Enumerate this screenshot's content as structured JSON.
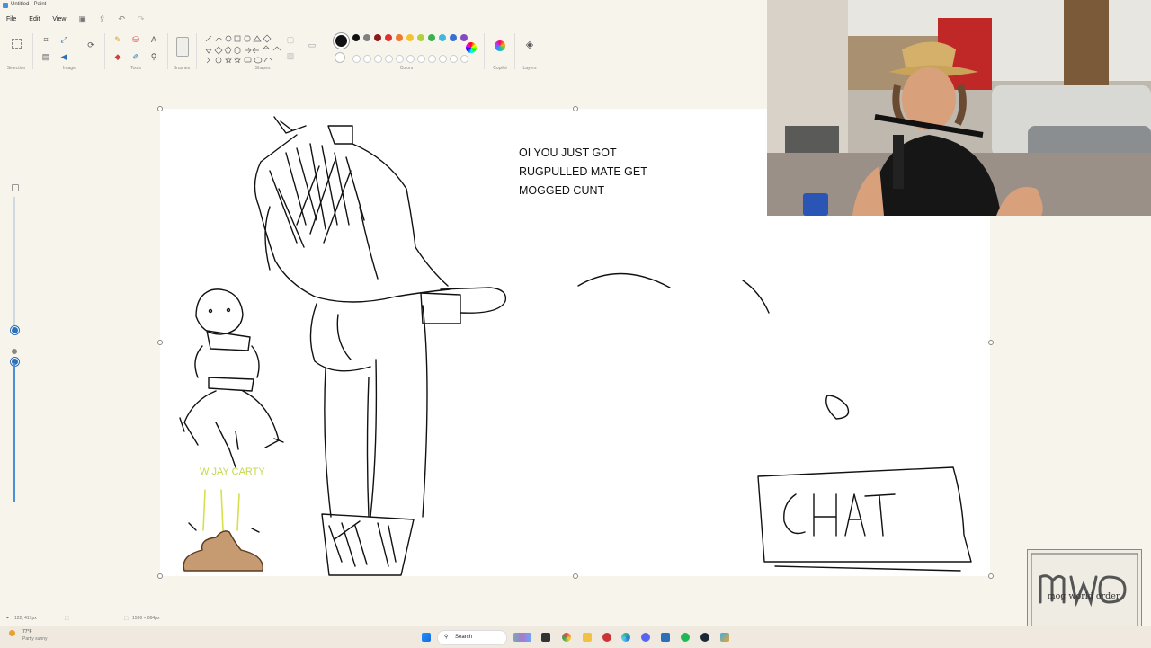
{
  "window": {
    "title": "Untitled - Paint"
  },
  "menu": {
    "file": "File",
    "edit": "Edit",
    "view": "View"
  },
  "ribbon": {
    "selection_label": "Selection",
    "image_label": "Image",
    "tools_label": "Tools",
    "brushes_label": "Brushes",
    "shapes_label": "Shapes",
    "colors_label": "Colors",
    "copilot_label": "Copilot",
    "layers_label": "Layers"
  },
  "palette": {
    "primary": "#111111",
    "row1": [
      "#111111",
      "#808080",
      "#8b1a1a",
      "#e03030",
      "#f07830",
      "#f4c430",
      "#b0d040",
      "#3cb050",
      "#40b8e0",
      "#3870d0",
      "#8848c0"
    ],
    "row2": [
      "#ffffff",
      "#c0c0c0",
      "#b07850",
      "#f4a0b0",
      "#f8c860",
      "#f8f0a0",
      "#d0f080",
      "#80e0a0",
      "#a0e0f0",
      "#a0b8e8",
      "#c8a8e8"
    ]
  },
  "canvas": {
    "text_lines": [
      "OI YOU JUST GOT",
      "RUGPULLED MATE GET",
      "MOGGED CUNT"
    ],
    "jay_text": "W JAY CARTY",
    "chat_text": "CHAT"
  },
  "status": {
    "cursor_position": "122, 417px",
    "canvas_size": "1536 × 864px"
  },
  "taskbar": {
    "weather_temp": "77°F",
    "weather_desc": "Partly sunny",
    "search_label": "Search"
  },
  "overlay": {
    "logo_text": "mwo",
    "logo_caption": "mog world order"
  },
  "colors": {
    "canvas_bg": "#ffffff",
    "app_bg": "#f7f4ec",
    "accent": "#2d6fb8",
    "jay_text": "#c6d94a"
  }
}
